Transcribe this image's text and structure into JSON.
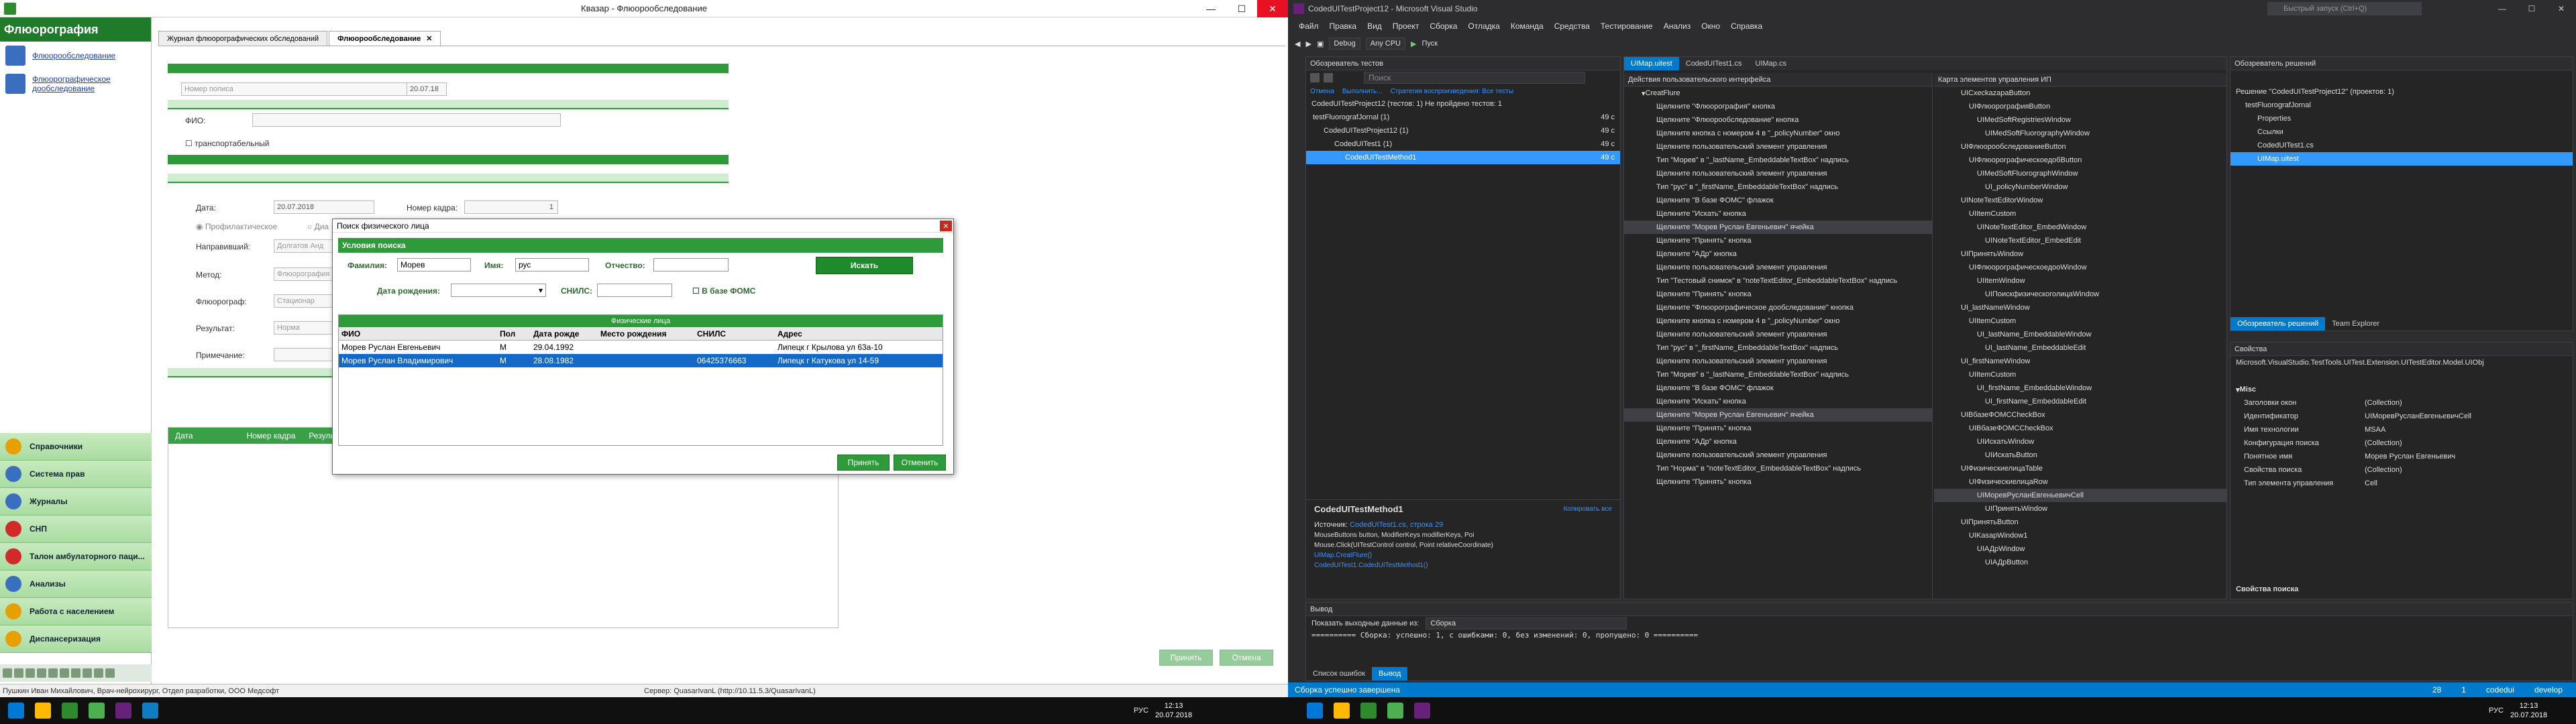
{
  "left_app": {
    "title": "Квазар - Флюорообследование",
    "window_controls": [
      "—",
      "☐",
      "✕"
    ],
    "sidebar_title": "Флюорография",
    "sidebar_links": [
      "Флюорообследование",
      "Флюорографическое дообследование"
    ],
    "menu_items": [
      {
        "label": "Справочники",
        "color": "#e8a000"
      },
      {
        "label": "Система прав",
        "color": "#3a6fbf"
      },
      {
        "label": "Журналы",
        "color": "#3a6fbf"
      },
      {
        "label": "СНП",
        "color": "#d12a2a"
      },
      {
        "label": "Талон амбулаторного паци...",
        "color": "#d12a2a"
      },
      {
        "label": "Анализы",
        "color": "#3a6fbf"
      },
      {
        "label": "Работа с населением",
        "color": "#e8a000"
      },
      {
        "label": "Диспансеризация",
        "color": "#e8a000"
      }
    ],
    "tabs": [
      "Журнал флюорографических обследований",
      "Флюорообследование"
    ],
    "tab_close": "✕",
    "form": {
      "policy_placeholder": "Номер полиса",
      "date_value": "20.07.18",
      "fio_label": "ФИО:",
      "transportable_label": "транспортабельный",
      "date_label": "Дата:",
      "date2_value": "20.07.2018",
      "frame_label": "Номер кадра:",
      "frame_value": "1",
      "type_prof": "Профилактическое",
      "type_diag": "Диа",
      "referred_label": "Направивший:",
      "referred_value": "Долгатов Анд",
      "method_label": "Метод:",
      "method_value": "Флюорография",
      "fluorograph_label": "Флюорограф:",
      "fluorograph_value": "Стационар",
      "result_label": "Результат:",
      "result_value": "Норма",
      "note_label": "Примечание:",
      "grid_columns": [
        "Дата",
        "Номер кадра",
        "Результ"
      ],
      "btn_accept": "Принять",
      "btn_cancel": "Отмена"
    },
    "status_user": "Пушкин Иван Михайлович, Врач-нейрохирург, Отдел разработки, ООО Медсофт",
    "status_server": "Сервер: QuasarIvanL (http://10.11.5.3/QuasarIvanL)"
  },
  "dialog": {
    "title": "Поиск физического лица",
    "close": "✕",
    "conditions_header": "Условия поиска",
    "surname_label": "Фамилия:",
    "surname_value": "Морев",
    "name_label": "Имя:",
    "name_value": "рус",
    "patronymic_label": "Отчество:",
    "patronymic_value": "",
    "search_btn": "Искать",
    "birth_label": "Дата рождения:",
    "snils_label": "СНИЛС:",
    "foms_label": "В базе ФОМС",
    "grid_caption": "Физические лица",
    "columns": [
      "ФИО",
      "Пол",
      "Дата рожде",
      "Место рождения",
      "СНИЛС",
      "Адрес"
    ],
    "rows": [
      {
        "fio": "Морев Руслан Евгеньевич",
        "sex": "М",
        "birth": "29.04.1992",
        "place": "",
        "snils": "",
        "address": "Липецк г Крылова ул 63а-10"
      },
      {
        "fio": "Морев Руслан Владимирович",
        "sex": "М",
        "birth": "28.08.1982",
        "place": "",
        "snils": "06425376663",
        "address": "Липецк г Катукова ул 14-59"
      }
    ],
    "accept_btn": "Принять",
    "cancel_btn": "Отменить"
  },
  "vs": {
    "title": "CodedUITestProject12 - Microsoft Visual Studio",
    "quick_launch": "Быстрый запуск (Ctrl+Q)",
    "menu": [
      "Файл",
      "Правка",
      "Вид",
      "Проект",
      "Сборка",
      "Отладка",
      "Команда",
      "Средства",
      "Тестирование",
      "Анализ",
      "Окно",
      "Справка"
    ],
    "toolbar": {
      "config": "Debug",
      "platform": "Any CPU",
      "run": "Пуск"
    },
    "test_explorer": {
      "title": "Обозреватель тестов",
      "search_placeholder": "Поиск",
      "actions": [
        "Отмена",
        "Выполнить...",
        "Стратегия воспроизведения: Все тесты"
      ],
      "summary": "CodedUITestProject12 (тестов: 1) Не пройдено тестов: 1",
      "tree": [
        {
          "label": "testFluorografJornal (1)",
          "time": "49 с"
        },
        {
          "label": "CodedUITestProject12 (1)",
          "time": "49 с"
        },
        {
          "label": "CodedUITest1 (1)",
          "time": "49 с"
        },
        {
          "label": "CodedUITestMethod1",
          "time": "49 с"
        }
      ],
      "detail_title": "CodedUITestMethod1",
      "detail_copy": "Копировать все",
      "detail_source_label": "Источник:",
      "detail_source": "CodedUITest1.cs, строка 29",
      "detail_lines": [
        "MouseButtons button, ModifierKeys modifierKeys, Poi",
        "Mouse.Click(UITestControl control, Point relativeCoordinate)",
        "UIMap.CreatFlure()",
        "CodedUITest1.CodedUITestMethod1()"
      ]
    },
    "uimap": {
      "tabs": [
        "UIMap.uitest",
        "CodedUITest1.cs",
        "UIMap.cs"
      ],
      "actions_title": "Действия пользовательского интерфейса",
      "controls_title": "Карта элементов управления ИП",
      "root_action": "CreatFlure",
      "actions": [
        "Щелкните \"Флюорография\" кнопка",
        "Щелкните \"Флюорообследование\" кнопка",
        "Щелкните кнопка с номером 4 в \"_policyNumber\" окно",
        "Щелкните пользовательский элемент управления",
        "Тип \"Морев\" в \"_lastName_EmbeddableTextBox\" надпись",
        "Щелкните пользовательский элемент управления",
        "Тип \"рус\" в \"_firstName_EmbeddableTextBox\" надпись",
        "Щелкните \"В базе ФОМС\" флажок",
        "Щелкните \"Искать\" кнопка",
        "Щелкните \"Морев Руслан Евгеньевич\" ячейка",
        "Щелкните \"Принять\" кнопка",
        "Щелкните \"АДр\" кнопка",
        "Щелкните пользовательский элемент управления",
        "Тип \"Тестовый снимок\" в \"noteTextEditor_EmbeddableTextBox\" надпись",
        "Щелкните \"Принять\" кнопка",
        "Щелкните \"Флюорографическое дообследование\" кнопка",
        "Щелкните кнопка с номером 4 в \"_policyNumber\" окно",
        "Щелкните пользовательский элемент управления",
        "Тип \"рус\" в \"_firstName_EmbeddableTextBox\" надпись",
        "Щелкните пользовательский элемент управления",
        "Тип \"Морев\" в \"_lastName_EmbeddableTextBox\" надпись",
        "Щелкните \"В базе ФОМС\" флажок",
        "Щелкните \"Искать\" кнопка",
        "Щелкните \"Морев Руслан Евгеньевич\" ячейка",
        "Щелкните \"Принять\" кнопка",
        "Щелкните \"АДр\" кнопка",
        "Щелкните пользовательский элемент управления",
        "Тип \"Норма\" в \"noteTextEditor_EmbeddableTextBox\" надпись",
        "Щелкните \"Принять\" кнопка"
      ],
      "controls": [
        "UICxeckazapaButton",
        "UIФлюорографияButton",
        "UIMedSoftRegistriesWindow",
        "UIMedSoftFluorographyWindow",
        "UIФлюорообследованиеButton",
        "UIФлюорографическоедобButton",
        "UIMedSoftFluorographWindow",
        "UI_policyNumberWindow",
        "UINoteTextEditorWindow",
        "UIItemCustom",
        "UINoteTextEditor_EmbedWindow",
        "UINoteTextEditor_EmbedEdit",
        "UIПринятьWindow",
        "UIФлюорографическоедооWindow",
        "UIItemWindow",
        "UIПоискфизическоголицаWindow",
        "UI_lastNameWindow",
        "UIItemCustom",
        "UI_lastName_EmbeddableWindow",
        "UI_lastName_EmbeddableEdit",
        "UI_firstNameWindow",
        "UIItemCustom",
        "UI_firstName_EmbeddableWindow",
        "UI_firstName_EmbeddableEdit",
        "UIВбазеФОМСCheckBox",
        "UIВбазеФОМСCheckBox",
        "UIИскатьWindow",
        "UIИскатьButton",
        "UIФизическиелицаTable",
        "UIФизическиелицаRow",
        "UIМоревРусланЕвгеньевичCell",
        "UIПринятьWindow",
        "UIПринятьButton",
        "UIKasapWindow1",
        "UIАДрWindow",
        "UIАДрButton"
      ]
    },
    "solution": {
      "title": "Обозреватель решений",
      "root": "Решение \"CodedUITestProject12\" (проектов: 1)",
      "items": [
        "testFluorografJornal",
        "Properties",
        "Ссылки",
        "CodedUITest1.cs",
        "UIMap.uitest"
      ],
      "bottom_tabs": [
        "Обозреватель решений",
        "Team Explorer"
      ]
    },
    "properties": {
      "title": "Свойства",
      "object": "Microsoft.VisualStudio.TestTools.UITest.Extension.UITestEditor.Model.UIObj",
      "section": "Misc",
      "rows": [
        [
          "Заголовки окон",
          "(Collection)"
        ],
        [
          "Идентификатор",
          "UIМоревРусланЕвгеньевичCell"
        ],
        [
          "Имя технологии",
          "MSAA"
        ],
        [
          "Конфигурация поиска",
          "(Collection)"
        ],
        [
          "Понятное имя",
          "Морев Руслан Евгеньевич"
        ],
        [
          "Свойства поиска",
          "(Collection)"
        ],
        [
          "Тип элемента управления",
          "Cell"
        ]
      ],
      "footer_title": "Свойства поиска"
    },
    "output": {
      "title": "Вывод",
      "show_label": "Показать выходные данные из:",
      "source": "Сборка",
      "text": "========== Сборка: успешно: 1, с ошибками: 0, без изменений: 0, пропущено: 0 ==========",
      "tabs": [
        "Список ошибок",
        "Вывод"
      ]
    },
    "status": {
      "left": "Сборка успешно завершена",
      "col": "28",
      "zoom": "1",
      "branch": "codedui",
      "branch2": "develop"
    }
  },
  "taskbar": {
    "time_left": "12:13",
    "date_left": "20.07.2018",
    "time_right": "12:13",
    "date_right": "20.07.2018",
    "lang": "РУС"
  },
  "colors": {
    "green": "#2e9a3a",
    "vs_blue": "#007acc",
    "selection": "#1469c7"
  }
}
